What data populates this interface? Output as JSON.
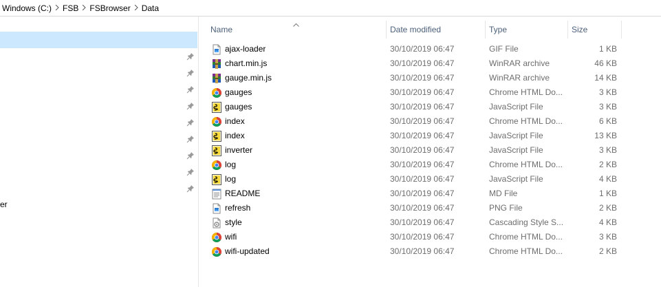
{
  "breadcrumb": {
    "items": [
      "Windows (C:)",
      "FSB",
      "FSBrowser",
      "Data"
    ]
  },
  "navigation": {
    "partial_item_label": "er",
    "pinned_count": 9
  },
  "details": {
    "columns": {
      "name": "Name",
      "date": "Date modified",
      "type": "Type",
      "size": "Size"
    },
    "files": [
      {
        "name": "ajax-loader",
        "date": "30/10/2019 06:47",
        "type": "GIF File",
        "size": "1 KB",
        "icon": "image-file-icon"
      },
      {
        "name": "chart.min.js",
        "date": "30/10/2019 06:47",
        "type": "WinRAR archive",
        "size": "46 KB",
        "icon": "winrar-archive-icon"
      },
      {
        "name": "gauge.min.js",
        "date": "30/10/2019 06:47",
        "type": "WinRAR archive",
        "size": "14 KB",
        "icon": "winrar-archive-icon"
      },
      {
        "name": "gauges",
        "date": "30/10/2019 06:47",
        "type": "Chrome HTML Do...",
        "size": "3 KB",
        "icon": "chrome-icon"
      },
      {
        "name": "gauges",
        "date": "30/10/2019 06:47",
        "type": "JavaScript File",
        "size": "3 KB",
        "icon": "javascript-file-icon"
      },
      {
        "name": "index",
        "date": "30/10/2019 06:47",
        "type": "Chrome HTML Do...",
        "size": "6 KB",
        "icon": "chrome-icon"
      },
      {
        "name": "index",
        "date": "30/10/2019 06:47",
        "type": "JavaScript File",
        "size": "13 KB",
        "icon": "javascript-file-icon"
      },
      {
        "name": "inverter",
        "date": "30/10/2019 06:47",
        "type": "JavaScript File",
        "size": "3 KB",
        "icon": "javascript-file-icon"
      },
      {
        "name": "log",
        "date": "30/10/2019 06:47",
        "type": "Chrome HTML Do...",
        "size": "2 KB",
        "icon": "chrome-icon"
      },
      {
        "name": "log",
        "date": "30/10/2019 06:47",
        "type": "JavaScript File",
        "size": "4 KB",
        "icon": "javascript-file-icon"
      },
      {
        "name": "README",
        "date": "30/10/2019 06:47",
        "type": "MD File",
        "size": "1 KB",
        "icon": "text-file-icon"
      },
      {
        "name": "refresh",
        "date": "30/10/2019 06:47",
        "type": "PNG File",
        "size": "2 KB",
        "icon": "image-file-icon"
      },
      {
        "name": "style",
        "date": "30/10/2019 06:47",
        "type": "Cascading Style S...",
        "size": "4 KB",
        "icon": "css-file-icon"
      },
      {
        "name": "wifi",
        "date": "30/10/2019 06:47",
        "type": "Chrome HTML Do...",
        "size": "3 KB",
        "icon": "chrome-icon"
      },
      {
        "name": "wifi-updated",
        "date": "30/10/2019 06:47",
        "type": "Chrome HTML Do...",
        "size": "2 KB",
        "icon": "chrome-icon"
      }
    ]
  },
  "colors": {
    "selection": "#cce8ff",
    "header_text": "#4c607a",
    "secondary_text": "#6d6d6d"
  }
}
